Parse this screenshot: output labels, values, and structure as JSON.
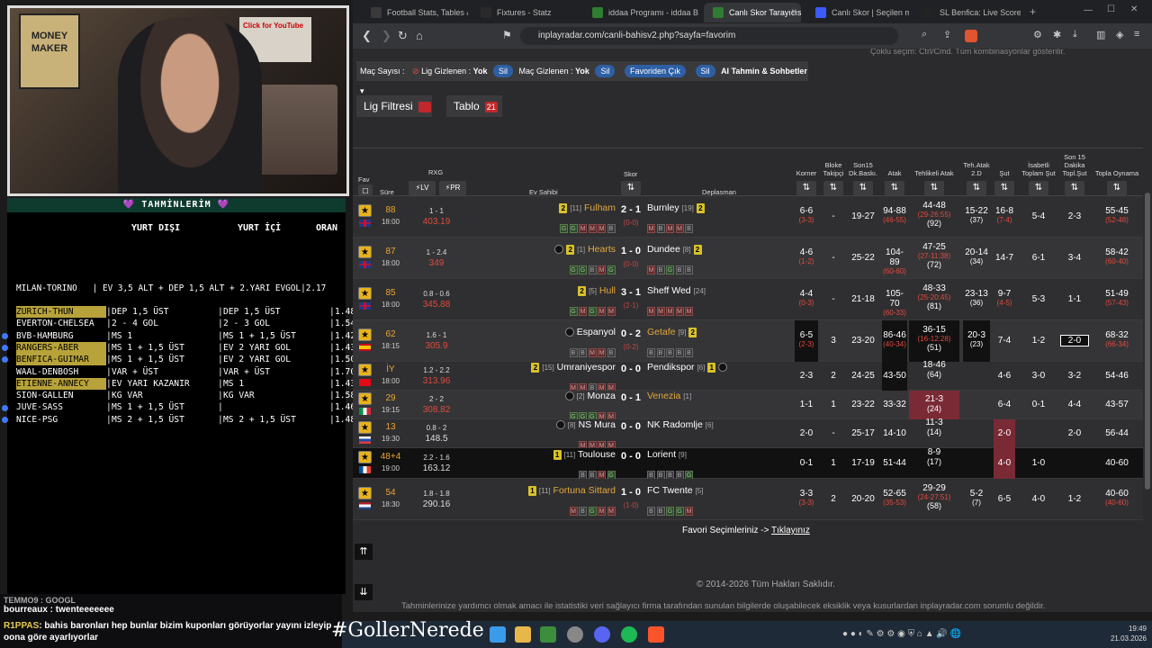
{
  "browser": {
    "tabs": [
      {
        "label": "Football Stats, Tables & D",
        "color": "#3a3a3a"
      },
      {
        "label": "Fixtures - Statz",
        "color": "#2a2a2a"
      },
      {
        "label": "iddaa Programı - iddaa B",
        "color": "#2e7d32"
      },
      {
        "label": "Canlı Skor Tarayıcısı",
        "color": "#2e7d32"
      },
      {
        "label": "Canlı Skor | Seçilen maçla",
        "color": "#3d5afe"
      },
      {
        "label": "SL Benfica: Live Scores, M",
        "color": "#222"
      }
    ],
    "url": "inplayradar.com/canli-bahisv2.php?sayfa=favorim"
  },
  "stream": {
    "poster_text": "MONEY MAKER",
    "poster2_text": "Click for YouTube"
  },
  "tahmin": {
    "title": "💜 TAHMİNLERİM 💜",
    "head_yurt_disi": "YURT DIŞI",
    "head_yurt_ici": "YURT İÇİ",
    "head_oran": "ORAN",
    "single": "MILAN-TORINO   | EV 3,5 ALT + DEP 1,5 ALT + 2.YARI EVGOL|2.17",
    "rows": [
      {
        "match": "ZURICH-THUN",
        "a": "DEP 1,5 ÜST",
        "b": "DEP 1,5 ÜST",
        "oran": "1.48",
        "hl": true
      },
      {
        "match": "EVERTON-CHELSEA",
        "a": "2 - 4 GOL",
        "b": "2 - 3 GOL",
        "oran": "1.54",
        "hl": false
      },
      {
        "match": "BVB-HAMBURG",
        "a": "MS 1",
        "b": "MS 1 + 1,5 ÜST",
        "oran": "1.42",
        "hl": false
      },
      {
        "match": "RANGERS-ABER",
        "a": "MS 1 + 1,5 ÜST",
        "b": "EV 2 YARI GOL",
        "oran": "1.43",
        "hl": true
      },
      {
        "match": "BENFICA-GUIMAR",
        "a": "MS 1 + 1,5 ÜST",
        "b": "EV 2 YARI GOL",
        "oran": "1.50",
        "hl": true
      },
      {
        "match": "WAAL-DENBOSH",
        "a": "VAR + ÜST",
        "b": "VAR + ÜST",
        "oran": "1.70",
        "hl": false
      },
      {
        "match": "ETIENNE-ANNECY",
        "a": "EV YARI KAZANIR",
        "b": "MS 1",
        "oran": "1.43",
        "hl": true
      },
      {
        "match": "SION-GALLEN",
        "a": "KG VAR",
        "b": "KG VAR",
        "oran": "1.58",
        "hl": false
      },
      {
        "match": "JUVE-SASS",
        "a": "MS 1 + 1,5 ÜST",
        "b": "",
        "oran": "1.46",
        "hl": false
      },
      {
        "match": "NICE-PSG",
        "a": "MS 2 + 1,5 ÜST",
        "b": "MS 2 + 1,5 ÜST",
        "oran": "1.48",
        "hl": false
      }
    ]
  },
  "chat": {
    "line1": "TEMMO9 : GOOGL",
    "line2": "bourreaux : twenteeeeeee",
    "user3": "R1PPAS",
    "msg3": ": bahis baronları hep bunlar bizim kuponları görüyorlar yayını izleyip oona göre ayarlıyorlar",
    "hashtag": "#GollerNerede"
  },
  "page": {
    "filter": {
      "mac_sayisi": "Maç Sayısı :",
      "lig_gizlenen": "Lig Gizlenen :",
      "lig_val": "Yok",
      "sil": "Sil",
      "mac_gizlenen": "Maç Gizlenen :",
      "mac_val": "Yok",
      "favoriden_cik": "Favoriden Çık",
      "ai": "AI Tahmin & Sohbetler ▾",
      "help": "Çoklu seçim: Ctrl/Cmd. Tüm kombinasyonlar gösterilir."
    },
    "lig_filtresi": "Lig Filtresi",
    "tablo": "Tablo",
    "tablo_count": "21",
    "headers": {
      "fav": "Fav",
      "sure": "Süre",
      "rxg": "RXG",
      "lv": "⚡LV",
      "pr": "⚡PR",
      "ev": "Ev Sahibi",
      "skor": "Skor",
      "dep": "Deplasman",
      "korner": "Korner",
      "bloke": "Bloke Takipçi",
      "son15": "Son15 Dk.Baskı.",
      "atak": "Atak",
      "tehlikeli": "Tehlikeli Atak",
      "tehatak": "Teh.Atak 2.D",
      "sut": "Şut",
      "isabetli": "İsabetli Toplam Şut",
      "son15sut": "Son 15 Dakika Topl.Şut",
      "topla": "Topla Oynama"
    },
    "matches": [
      {
        "flag": "uk",
        "min": "88",
        "time": "18:00",
        "xg1": "1 - 1",
        "xg2": "403.19",
        "home": "Fulham",
        "hrank": "[11]",
        "hcard": "2",
        "homeGold": true,
        "hform": "GGMMMB",
        "score": "2 - 1",
        "ht": "(0-0)",
        "away": "Burnley",
        "arank": "[19]",
        "acard": "2",
        "awayGold": false,
        "aform": "MBMMB",
        "korner": "6-6",
        "korner_s": "(3-3)",
        "bloke": "-",
        "son15": "19-27",
        "atak": "94-88",
        "atak_s": "(46-55)",
        "teh": "44-48",
        "teh_s": "(29-26:55)",
        "teh_t": "(92)",
        "teh2": "15-22",
        "teh2_s": "(37)",
        "sut": "16-8",
        "sut_s": "(7-4)",
        "isabet": "5-4",
        "son15sut": "2-3",
        "topla": "55-45",
        "topla_s": "(52-48)"
      },
      {
        "flag": "uk",
        "min": "87",
        "time": "18:00",
        "xg1": "1 - 2.4",
        "xg2": "349",
        "home": "Hearts",
        "hrank": "[1]",
        "hcard": "2",
        "homeGold": true,
        "hform": "GGBMG",
        "score": "1 - 0",
        "ht": "(0-0)",
        "away": "Dundee",
        "arank": "[8]",
        "acard": "2",
        "awayGold": false,
        "aform": "MBGBB",
        "korner": "4-6",
        "korner_s": "(1-2)",
        "bloke": "-",
        "son15": "25-22",
        "atak": "104-89",
        "atak_s": "(60-60)",
        "teh": "47-25",
        "teh_s": "(27-11:38)",
        "teh_t": "(72)",
        "teh2": "20-14",
        "teh2_s": "(34)",
        "sut": "14-7",
        "sut_s": "",
        "isabet": "6-1",
        "son15sut": "3-4",
        "topla": "58-42",
        "topla_s": "(60-40)"
      },
      {
        "flag": "uk",
        "min": "85",
        "time": "18:00",
        "xg1": "0.8 - 0.6",
        "xg2": "345.88",
        "home": "Hull",
        "hrank": "[5]",
        "hcard": "2",
        "homeGold": true,
        "hform": "GMGMM",
        "score": "3 - 1",
        "ht": "(2-1)",
        "away": "Sheff Wed",
        "arank": "[24]",
        "acard": "",
        "awayGold": false,
        "aform": "MMMMM",
        "korner": "4-4",
        "korner_s": "(0-3)",
        "bloke": "-",
        "son15": "21-18",
        "atak": "105-70",
        "atak_s": "(60-33)",
        "teh": "48-33",
        "teh_s": "(25-20:45)",
        "teh_t": "(81)",
        "teh2": "23-13",
        "teh2_s": "(36)",
        "sut": "9-7",
        "sut_s": "(4-5)",
        "isabet": "5-3",
        "son15sut": "1-1",
        "topla": "51-49",
        "topla_s": "(57-43)"
      },
      {
        "flag": "es",
        "min": "62",
        "time": "18:15",
        "xg1": "1.6 - 1",
        "xg2": "305.9",
        "home": "Espanyol",
        "hrank": "",
        "hcard": "",
        "homeGold": false,
        "hform": "BBMMB",
        "score": "0 - 2",
        "ht": "(0-2)",
        "away": "Getafe",
        "arank": "[9]",
        "acard": "2",
        "awayGold": true,
        "aform": "BBBBB",
        "korner": "6-5",
        "korner_s": "(2-3)",
        "bloke": "3",
        "son15": "23-20",
        "atak": "86-46",
        "atak_s": "(40-34)",
        "teh": "36-15",
        "teh_s": "(16-12:28)",
        "teh_t": "(51)",
        "teh2": "20-3",
        "teh2_s": "(23)",
        "sut": "7-4",
        "sut_s": "",
        "isabet": "1-2",
        "son15sut": "2-0",
        "topla": "68-32",
        "topla_s": "(66-34)"
      },
      {
        "flag": "tr",
        "min": "İY",
        "time": "18:00",
        "xg1": "1.2 - 2.2",
        "xg2": "313.96",
        "home": "Umraniyespor",
        "hrank": "[15]",
        "hcard": "2",
        "homeGold": false,
        "hform": "MMBMM",
        "score": "0 - 0",
        "ht": "",
        "away": "Pendikspor",
        "arank": "[6]",
        "acard": "1",
        "awayGold": false,
        "aform": "",
        "korner": "2-3",
        "korner_s": "",
        "bloke": "2",
        "son15": "24-25",
        "atak": "43-50",
        "atak_s": "",
        "teh": "18-46",
        "teh_s": "",
        "teh_t": "(64)",
        "teh2": "",
        "teh2_s": "",
        "sut": "4-6",
        "sut_s": "",
        "isabet": "3-0",
        "son15sut": "3-2",
        "topla": "54-46",
        "topla_s": ""
      },
      {
        "flag": "it",
        "min": "29",
        "time": "19:15",
        "xg1": "2 - 2",
        "xg2": "308.82",
        "home": "Monza",
        "hrank": "[2]",
        "hcard": "",
        "homeGold": false,
        "hform": "GGGMM",
        "score": "0 - 1",
        "ht": "",
        "away": "Venezia",
        "arank": "[1]",
        "acard": "",
        "awayGold": true,
        "aform": "",
        "korner": "1-1",
        "korner_s": "",
        "bloke": "1",
        "son15": "23-22",
        "atak": "33-32",
        "atak_s": "",
        "teh": "21-3",
        "teh_s": "",
        "teh_t": "(24)",
        "teh2": "",
        "teh2_s": "",
        "sut": "6-4",
        "sut_s": "",
        "isabet": "0-1",
        "son15sut": "4-4",
        "topla": "43-57",
        "topla_s": ""
      },
      {
        "flag": "si",
        "min": "13",
        "time": "19:30",
        "xg1": "0.8 - 2",
        "xg2": "148.5",
        "home": "NS Mura",
        "hrank": "[8]",
        "hcard": "",
        "homeGold": false,
        "hform": "MMMM",
        "score": "0 - 0",
        "ht": "",
        "away": "NK Radomlje",
        "arank": "[6]",
        "acard": "",
        "awayGold": false,
        "aform": "",
        "korner": "2-0",
        "korner_s": "",
        "bloke": "-",
        "son15": "25-17",
        "atak": "14-10",
        "atak_s": "",
        "teh": "11-3",
        "teh_s": "",
        "teh_t": "(14)",
        "teh2": "",
        "teh2_s": "",
        "sut": "2-0",
        "sut_s": "",
        "isabet": "",
        "son15sut": "2-0",
        "topla": "56-44",
        "topla_s": ""
      },
      {
        "flag": "fr",
        "min": "48+4",
        "time": "19:00",
        "xg1": "2.2 - 1.6",
        "xg2": "163.12",
        "home": "Toulouse",
        "hrank": "[11]",
        "hcard": "1",
        "homeGold": false,
        "hform": "BBMG",
        "score": "0 - 0",
        "ht": "",
        "away": "Lorient",
        "arank": "[9]",
        "acard": "",
        "awayGold": false,
        "aform": "BBBBG",
        "korner": "0-1",
        "korner_s": "",
        "bloke": "1",
        "son15": "17-19",
        "atak": "51-44",
        "atak_s": "",
        "teh": "8-9",
        "teh_s": "",
        "teh_t": "(17)",
        "teh2": "",
        "teh2_s": "",
        "sut": "4-0",
        "sut_s": "",
        "isabet": "1-0",
        "son15sut": "",
        "topla": "40-60",
        "topla_s": ""
      },
      {
        "flag": "nl",
        "min": "54",
        "time": "18:30",
        "xg1": "1.8 - 1.8",
        "xg2": "290.16",
        "home": "Fortuna Sittard",
        "hrank": "[11]",
        "hcard": "1",
        "homeGold": true,
        "hform": "MBGMM",
        "score": "1 - 0",
        "ht": "(1-0)",
        "away": "FC Twente",
        "arank": "[5]",
        "acard": "",
        "awayGold": false,
        "aform": "BBGGM",
        "korner": "3-3",
        "korner_s": "(3-3)",
        "bloke": "2",
        "son15": "20-20",
        "atak": "52-65",
        "atak_s": "(35-53)",
        "teh": "29-29",
        "teh_s": "(24-27:51)",
        "teh_t": "(58)",
        "teh2": "5-2",
        "teh2_s": "(7)",
        "sut": "6-5",
        "sut_s": "",
        "isabet": "4-0",
        "son15sut": "1-2",
        "topla": "40-60",
        "topla_s": "(40-60)"
      }
    ],
    "favori_text": "Favori Seçimleriniz ->",
    "favori_link": "Tıklayınız",
    "copyright": "© 2014-2026 Tüm Hakları Saklıdır.",
    "disclaimer": "Tahminlerinize yardımcı olmak amacı ile istatistiki veri sağlayıcı firma tarafından sunulan bilgilerde oluşabilecek eksiklik veya kusurlardan inplayradar.com sorumlu değildir."
  },
  "taskbar": {
    "time": "19:49",
    "date": "21.03.2026"
  }
}
